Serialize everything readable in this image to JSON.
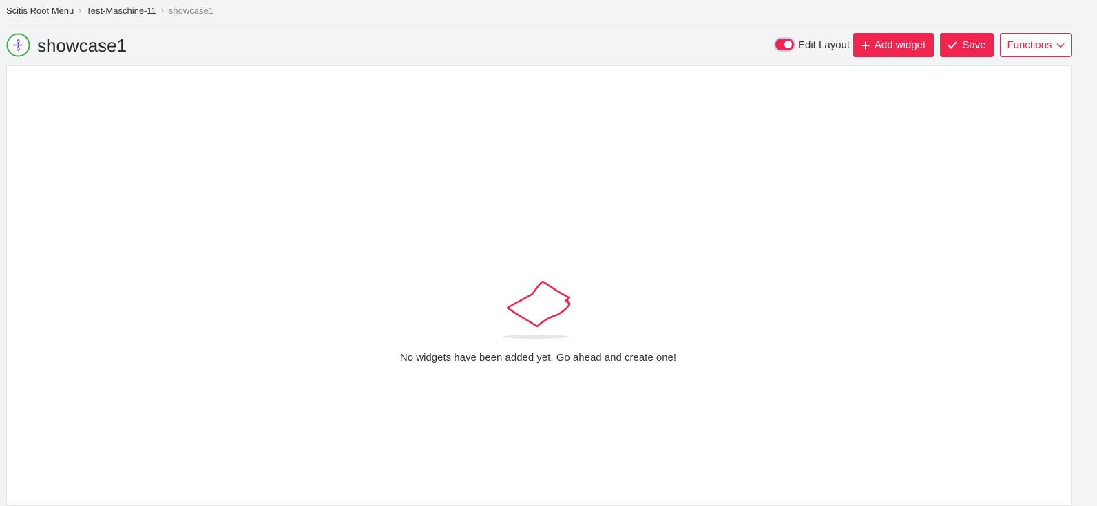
{
  "breadcrumb": {
    "items": [
      "Scitis Root Menu",
      "Test-Maschine-11"
    ],
    "current": "showcase1",
    "separator": ">"
  },
  "page": {
    "title": "showcase1",
    "icon": "dashboard-icon"
  },
  "toolbar": {
    "edit_layout_label": "Edit Layout",
    "edit_layout_on": true,
    "add_widget_label": "Add widget",
    "save_label": "Save",
    "functions_label": "Functions"
  },
  "empty_state": {
    "message": "No widgets have been added yet. Go ahead and create one!",
    "icon": "empty-paper-icon"
  },
  "colors": {
    "accent": "#f0254f",
    "icon_ring": "#3fae49",
    "background": "#f3f4f6"
  }
}
